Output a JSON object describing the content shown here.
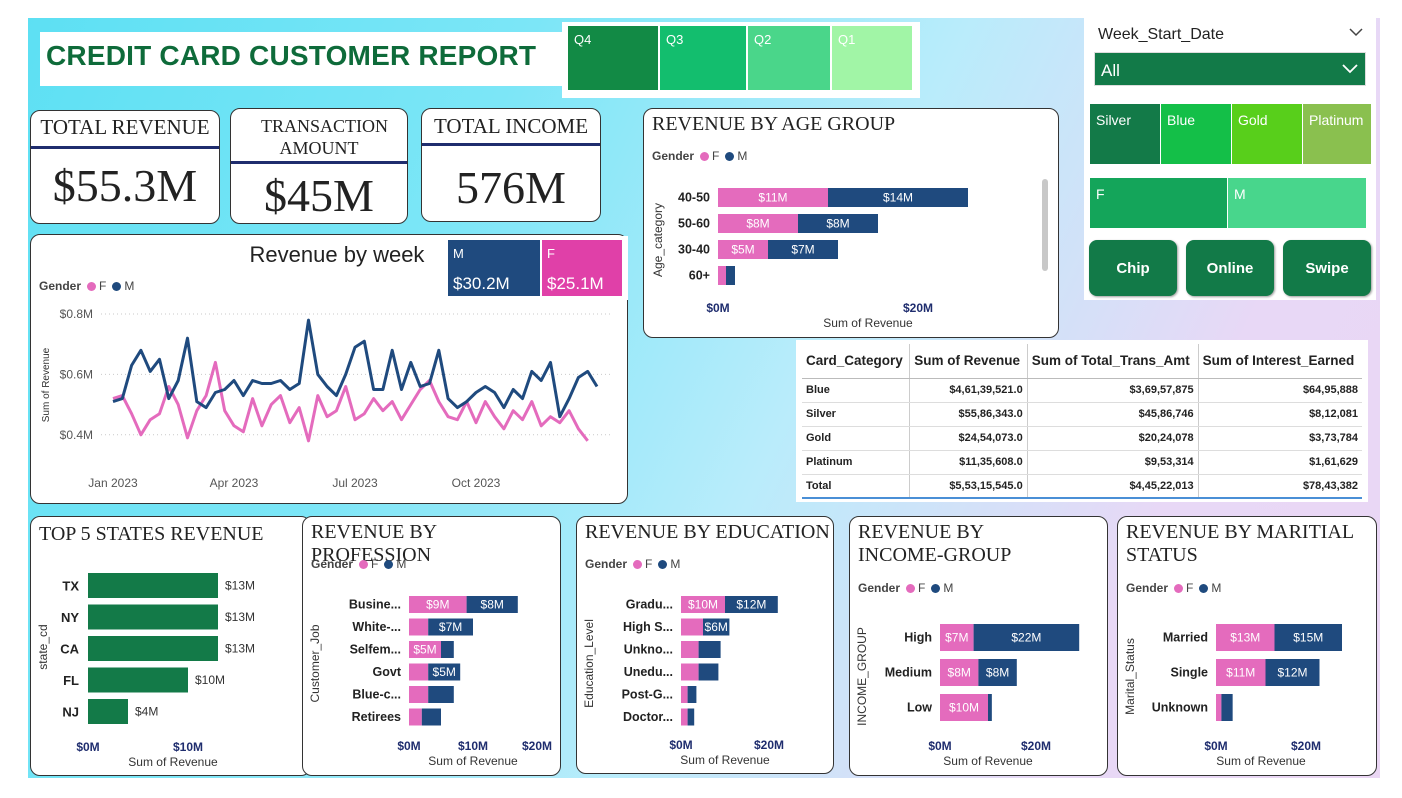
{
  "report_title": "CREDIT CARD CUSTOMER REPORT",
  "quarter_slicer": [
    {
      "label": "Q4",
      "color": "#128a45"
    },
    {
      "label": "Q3",
      "color": "#13be6e"
    },
    {
      "label": "Q2",
      "color": "#4ad68a"
    },
    {
      "label": "Q1",
      "color": "#a1f5a6"
    }
  ],
  "kpis": {
    "total_revenue": {
      "title": "TOTAL REVENUE",
      "value": "$55.3M"
    },
    "transaction_amount": {
      "title": "TRANSACTION AMOUNT",
      "value": "$45M"
    },
    "total_income": {
      "title": "TOTAL INCOME",
      "value": "576M"
    }
  },
  "week_filter": {
    "label": "Week_Start_Date",
    "selected": "All"
  },
  "card_slicer": [
    {
      "label": "Silver",
      "color": "#137a48"
    },
    {
      "label": "Blue",
      "color": "#14bf48"
    },
    {
      "label": "Gold",
      "color": "#58cf1b"
    },
    {
      "label": "Platinum",
      "color": "#8ac04f"
    }
  ],
  "gender_slicer": [
    {
      "label": "F",
      "color": "#14a55a"
    },
    {
      "label": "M",
      "color": "#48d68c"
    }
  ],
  "payment_buttons": [
    "Chip",
    "Online",
    "Swipe"
  ],
  "colors": {
    "female": "#e46bbd",
    "male": "#1f4a7e",
    "green": "#137a48"
  },
  "gender_cards": {
    "m": {
      "label": "M",
      "value": "$30.2M",
      "color": "#1f4a7e"
    },
    "f": {
      "label": "F",
      "value": "$25.1M",
      "color": "#e040a8"
    }
  },
  "legend": {
    "title": "Gender",
    "f": "F",
    "m": "M"
  },
  "chart_titles": {
    "age": "REVENUE BY AGE GROUP",
    "week": "Revenue by week",
    "states": "TOP 5 STATES REVENUE",
    "profession": "REVENUE BY PROFESSION",
    "education": "REVENUE BY EDUCATION",
    "income": "REVENUE BY INCOME-GROUP",
    "marital": "REVENUE BY MARITIAL STATUS"
  },
  "chart_data": [
    {
      "type": "bar",
      "id": "age",
      "title": "REVENUE BY AGE GROUP",
      "ylabel": "Age_category",
      "xlabel": "Sum of Revenue",
      "categories": [
        "40-50",
        "50-60",
        "30-40",
        "60+"
      ],
      "series": [
        {
          "name": "F",
          "values": [
            11,
            8,
            5,
            0.8
          ],
          "labels": [
            "$11M",
            "$8M",
            "$5M",
            ""
          ]
        },
        {
          "name": "M",
          "values": [
            14,
            8,
            7,
            0.9
          ],
          "labels": [
            "$14M",
            "$8M",
            "$7M",
            ""
          ]
        }
      ],
      "xticks": [
        "$0M",
        "$20M"
      ],
      "xlim": [
        0,
        30
      ]
    },
    {
      "type": "line",
      "id": "week",
      "title": "Revenue by week",
      "ylabel": "Sum of Revenue",
      "yticks": [
        "$0.4M",
        "$0.6M",
        "$0.8M"
      ],
      "ylim": [
        0.3,
        0.83
      ],
      "xticks": [
        "Jan 2023",
        "Apr 2023",
        "Jul 2023",
        "Oct 2023"
      ],
      "xtick_weeks": [
        0,
        13,
        26,
        39
      ],
      "series": [
        {
          "name": "F",
          "values": [
            0.52,
            0.53,
            0.47,
            0.4,
            0.45,
            0.47,
            0.56,
            0.5,
            0.39,
            0.48,
            0.53,
            0.64,
            0.48,
            0.43,
            0.41,
            0.52,
            0.43,
            0.5,
            0.53,
            0.44,
            0.49,
            0.38,
            0.53,
            0.46,
            0.48,
            0.56,
            0.45,
            0.47,
            0.52,
            0.48,
            0.51,
            0.45,
            0.5,
            0.55,
            0.58,
            0.51,
            0.46,
            0.45,
            0.51,
            0.44,
            0.51,
            0.46,
            0.42,
            0.48,
            0.45,
            0.51,
            0.43,
            0.46,
            0.44,
            0.48,
            0.42,
            0.38
          ]
        },
        {
          "name": "M",
          "values": [
            0.51,
            0.52,
            0.63,
            0.68,
            0.61,
            0.65,
            0.52,
            0.58,
            0.72,
            0.51,
            0.49,
            0.54,
            0.55,
            0.58,
            0.53,
            0.58,
            0.57,
            0.57,
            0.58,
            0.55,
            0.57,
            0.78,
            0.6,
            0.56,
            0.53,
            0.6,
            0.69,
            0.71,
            0.55,
            0.55,
            0.68,
            0.55,
            0.64,
            0.56,
            0.57,
            0.68,
            0.52,
            0.49,
            0.51,
            0.54,
            0.56,
            0.54,
            0.49,
            0.55,
            0.52,
            0.61,
            0.58,
            0.64,
            0.46,
            0.52,
            0.59,
            0.61,
            0.56
          ]
        }
      ]
    },
    {
      "type": "bar",
      "id": "states",
      "title": "TOP 5 STATES REVENUE",
      "ylabel": "state_cd",
      "xlabel": "Sum of Revenue",
      "categories": [
        "TX",
        "NY",
        "CA",
        "FL",
        "NJ"
      ],
      "values": [
        13,
        13,
        13,
        10,
        4
      ],
      "labels": [
        "$13M",
        "$13M",
        "$13M",
        "$10M",
        "$4M"
      ],
      "xticks": [
        "$0M",
        "$10M"
      ],
      "xlim": [
        0,
        20
      ]
    },
    {
      "type": "bar",
      "id": "profession",
      "title": "REVENUE BY PROFESSION",
      "ylabel": "Customer_Job",
      "xlabel": "Sum of Revenue",
      "categories": [
        "Busine...",
        "White-...",
        "Selfem...",
        "Govt",
        "Blue-c...",
        "Retirees"
      ],
      "series": [
        {
          "name": "F",
          "values": [
            9,
            3,
            5,
            3,
            3,
            2
          ],
          "labels": [
            "$9M",
            "",
            "$5M",
            "",
            "",
            ""
          ]
        },
        {
          "name": "M",
          "values": [
            8,
            7,
            2,
            5,
            4,
            3
          ],
          "labels": [
            "$8M",
            "$7M",
            "",
            "$5M",
            "",
            ""
          ]
        }
      ],
      "xticks": [
        "$0M",
        "$10M",
        "$20M"
      ],
      "xlim": [
        0,
        20
      ]
    },
    {
      "type": "bar",
      "id": "education",
      "title": "REVENUE BY EDUCATION",
      "ylabel": "Education_Level",
      "xlabel": "Sum of Revenue",
      "categories": [
        "Gradu...",
        "High S...",
        "Unkno...",
        "Unedu...",
        "Post-G...",
        "Doctor..."
      ],
      "series": [
        {
          "name": "F",
          "values": [
            10,
            5,
            4,
            4,
            1.5,
            1.5
          ],
          "labels": [
            "$10M",
            "",
            "",
            "",
            "",
            ""
          ]
        },
        {
          "name": "M",
          "values": [
            12,
            6,
            5,
            4.5,
            2,
            1.5
          ],
          "labels": [
            "$12M",
            "$6M",
            "",
            "",
            "",
            ""
          ]
        }
      ],
      "xticks": [
        "$0M",
        "$20M"
      ],
      "xlim": [
        0,
        20
      ]
    },
    {
      "type": "bar",
      "id": "income",
      "title": "REVENUE BY INCOME-GROUP",
      "ylabel": "INCOME_GROUP",
      "xlabel": "Sum of Revenue",
      "categories": [
        "High",
        "Medium",
        "Low"
      ],
      "series": [
        {
          "name": "F",
          "values": [
            7,
            8,
            10
          ],
          "labels": [
            "$7M",
            "$8M",
            "$10M"
          ]
        },
        {
          "name": "M",
          "values": [
            22,
            8,
            0.8
          ],
          "labels": [
            "$22M",
            "$8M",
            ""
          ]
        }
      ],
      "xticks": [
        "$0M",
        "$20M"
      ],
      "xlim": [
        0,
        20
      ]
    },
    {
      "type": "bar",
      "id": "marital",
      "title": "REVENUE BY MARITIAL STATUS",
      "ylabel": "Marital_Status",
      "xlabel": "Sum of Revenue",
      "categories": [
        "Married",
        "Single",
        "Unknown"
      ],
      "series": [
        {
          "name": "F",
          "values": [
            13,
            11,
            1.2
          ],
          "labels": [
            "$13M",
            "$11M",
            ""
          ]
        },
        {
          "name": "M",
          "values": [
            15,
            12,
            2.5
          ],
          "labels": [
            "$15M",
            "$12M",
            ""
          ]
        }
      ],
      "xticks": [
        "$0M",
        "$20M"
      ],
      "xlim": [
        0,
        20
      ]
    },
    {
      "type": "table",
      "id": "card_table",
      "columns": [
        "Card_Category",
        "Sum of Revenue",
        "Sum of Total_Trans_Amt",
        "Sum of Interest_Earned"
      ],
      "rows": [
        [
          "Blue",
          "$4,61,39,521.0",
          "$3,69,57,875",
          "$64,95,888"
        ],
        [
          "Silver",
          "$55,86,343.0",
          "$45,86,746",
          "$8,12,081"
        ],
        [
          "Gold",
          "$24,54,073.0",
          "$20,24,078",
          "$3,73,784"
        ],
        [
          "Platinum",
          "$11,35,608.0",
          "$9,53,314",
          "$1,61,629"
        ]
      ],
      "total": [
        "Total",
        "$5,53,15,545.0",
        "$4,45,22,013",
        "$78,43,382"
      ]
    }
  ]
}
